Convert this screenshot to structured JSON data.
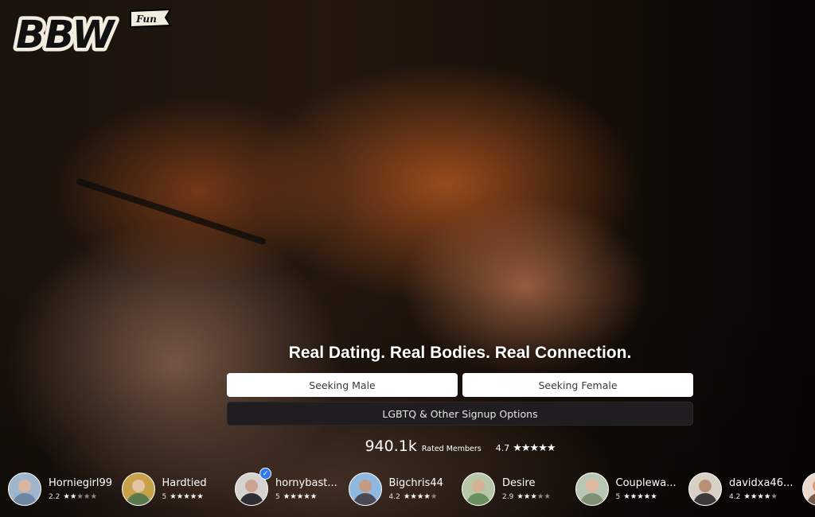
{
  "brand": {
    "logo_text": "BBW",
    "logo_badge": "Fun"
  },
  "hero": {
    "headline": "Real Dating. Real Bodies. Real Connection."
  },
  "cta": {
    "seeking_male": "Seeking Male",
    "seeking_female": "Seeking Female",
    "other_options": "LGBTQ & Other Signup Options"
  },
  "stats": {
    "members_count": "940.1k",
    "members_label": "Rated Members",
    "average_rating": "4.7",
    "average_stars": "★★★★★"
  },
  "members": [
    {
      "name": "Horniegirl99",
      "rating": "2.2",
      "stars": 2.2,
      "verified": false,
      "colors": [
        "#9fb5cc",
        "#d9b59b",
        "#6d86a3"
      ]
    },
    {
      "name": "Hardtied",
      "rating": "5",
      "stars": 5,
      "verified": false,
      "colors": [
        "#c7a24a",
        "#e2c3a3",
        "#5a7a4f"
      ]
    },
    {
      "name": "hornybast...",
      "rating": "5",
      "stars": 5,
      "verified": true,
      "colors": [
        "#d6d2cf",
        "#c9a590",
        "#2f2f33"
      ]
    },
    {
      "name": "Bigchris44",
      "rating": "4.2",
      "stars": 4.2,
      "verified": false,
      "colors": [
        "#8fb8e0",
        "#c59a80",
        "#4a4a55"
      ]
    },
    {
      "name": "Desire",
      "rating": "2.9",
      "stars": 2.9,
      "verified": false,
      "colors": [
        "#b8c6a8",
        "#d8b093",
        "#6b8f5e"
      ]
    },
    {
      "name": "Couplewa...",
      "rating": "5",
      "stars": 5,
      "verified": false,
      "colors": [
        "#b9c7b2",
        "#e1b79d",
        "#7f9074"
      ]
    },
    {
      "name": "davidxa46...",
      "rating": "4.2",
      "stars": 4.2,
      "verified": false,
      "colors": [
        "#d8d0c4",
        "#b89078",
        "#3c3a38"
      ]
    },
    {
      "name": "",
      "rating": "",
      "stars": 0,
      "verified": false,
      "colors": [
        "#e8d9cc",
        "#d49a7a",
        "#7a5a4a"
      ]
    }
  ],
  "colors": {
    "cta_light_bg": "#ffffff",
    "cta_dark_bg": "#1f1d1f",
    "verified_badge": "#2f7bea",
    "logo_cream": "#f3ece0"
  }
}
